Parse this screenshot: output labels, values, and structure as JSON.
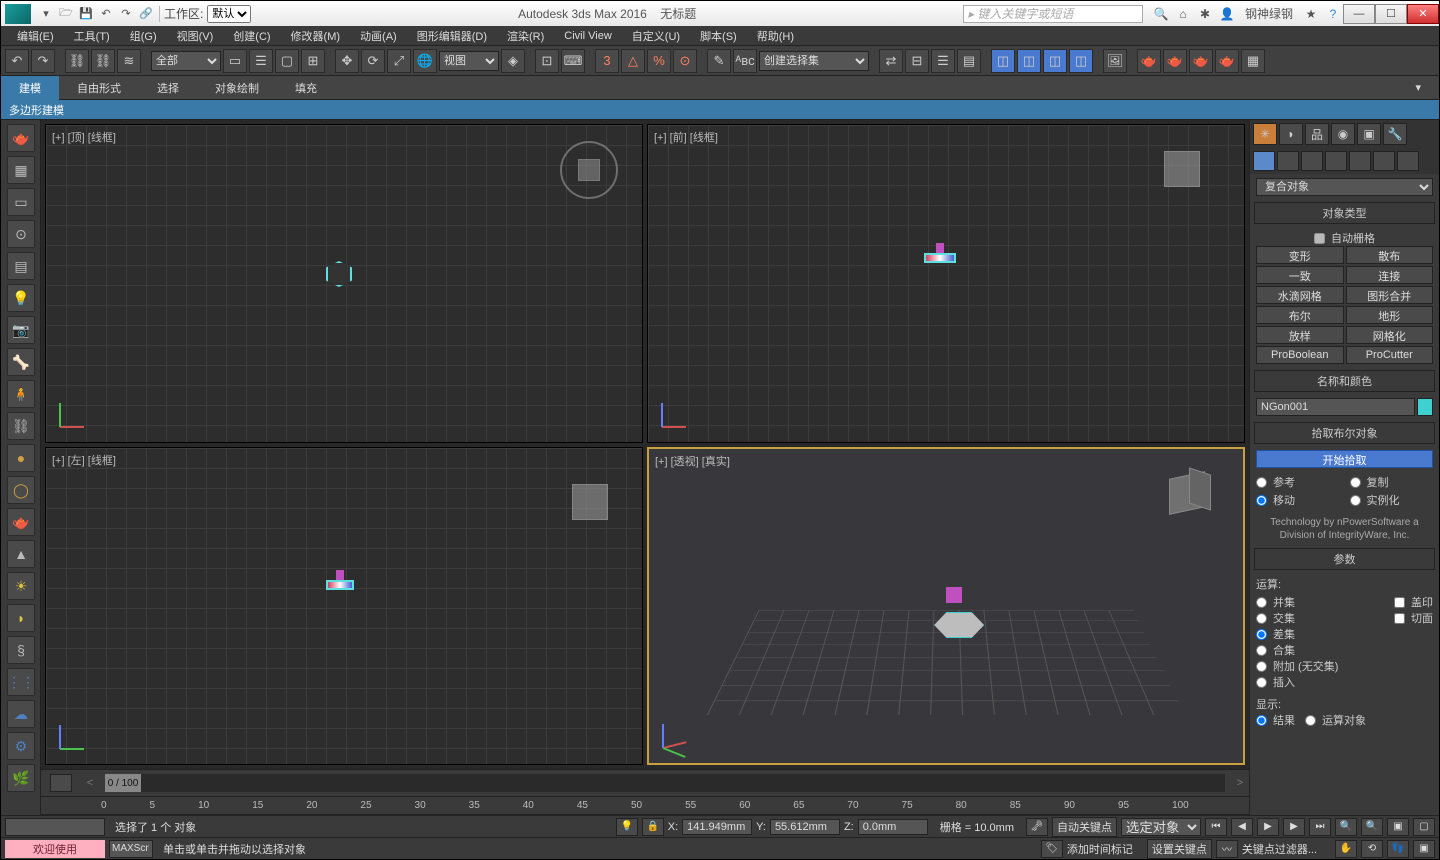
{
  "title": {
    "app": "Autodesk 3ds Max 2016",
    "doc": "无标题",
    "workspace_label": "工作区:",
    "workspace_value": "默认",
    "search_ph": "键入关键字或短语",
    "user": "钢神绿钢"
  },
  "menu": [
    "编辑(E)",
    "工具(T)",
    "组(G)",
    "视图(V)",
    "创建(C)",
    "修改器(M)",
    "动画(A)",
    "图形编辑器(D)",
    "渲染(R)",
    "Civil View",
    "自定义(U)",
    "脚本(S)",
    "帮助(H)"
  ],
  "toolbar": {
    "sel_filter": "全部",
    "view_mode": "视图",
    "named_set": "创建选择集"
  },
  "ribbon": {
    "tabs": [
      "建模",
      "自由形式",
      "选择",
      "对象绘制",
      "填充"
    ],
    "sub": "多边形建模"
  },
  "views": {
    "top": "[+] [顶] [线框]",
    "front": "[+] [前] [线框]",
    "left": "[+] [左] [线框]",
    "persp": "[+] [透视] [真实]"
  },
  "cmd": {
    "dropdown": "复合对象",
    "objtype_hdr": "对象类型",
    "autogrid": "自动栅格",
    "buttons": [
      "变形",
      "散布",
      "一致",
      "连接",
      "水滴网格",
      "图形合并",
      "布尔",
      "地形",
      "放样",
      "网格化",
      "ProBoolean",
      "ProCutter"
    ],
    "namecolor_hdr": "名称和颜色",
    "obj_name": "NGon001",
    "pick_hdr": "拾取布尔对象",
    "pick_btn": "开始拾取",
    "ref": "参考",
    "copy": "复制",
    "move": "移动",
    "inst": "实例化",
    "tech": "Technology by nPowerSoftware a Division of IntegrityWare, Inc.",
    "params_hdr": "参数",
    "op_label": "运算:",
    "ops": [
      "并集",
      "交集",
      "差集",
      "合集",
      "附加 (无交集)",
      "插入"
    ],
    "op_checks": [
      "盖印",
      "切面"
    ],
    "disp_label": "显示:",
    "disp_result": "结果",
    "disp_operand": "运算对象"
  },
  "timeline": {
    "frame": "0 / 100",
    "ticks": [
      "0",
      "5",
      "10",
      "15",
      "20",
      "25",
      "30",
      "35",
      "40",
      "45",
      "50",
      "55",
      "60",
      "65",
      "70",
      "75",
      "80",
      "85",
      "90",
      "95",
      "100"
    ]
  },
  "status": {
    "welcome": "欢迎使用",
    "maxscript": "MAXScr",
    "line1": "选择了 1 个 对象",
    "line2": "单击或单击并拖动以选择对象",
    "x": "141.949mm",
    "y": "55.612mm",
    "z": "0.0mm",
    "grid": "栅格 = 10.0mm",
    "autokey": "自动关键点",
    "selkey": "选定对象",
    "setkey": "设置关键点",
    "keyfilter": "关键点过滤器...",
    "addtm": "添加时间标记"
  }
}
